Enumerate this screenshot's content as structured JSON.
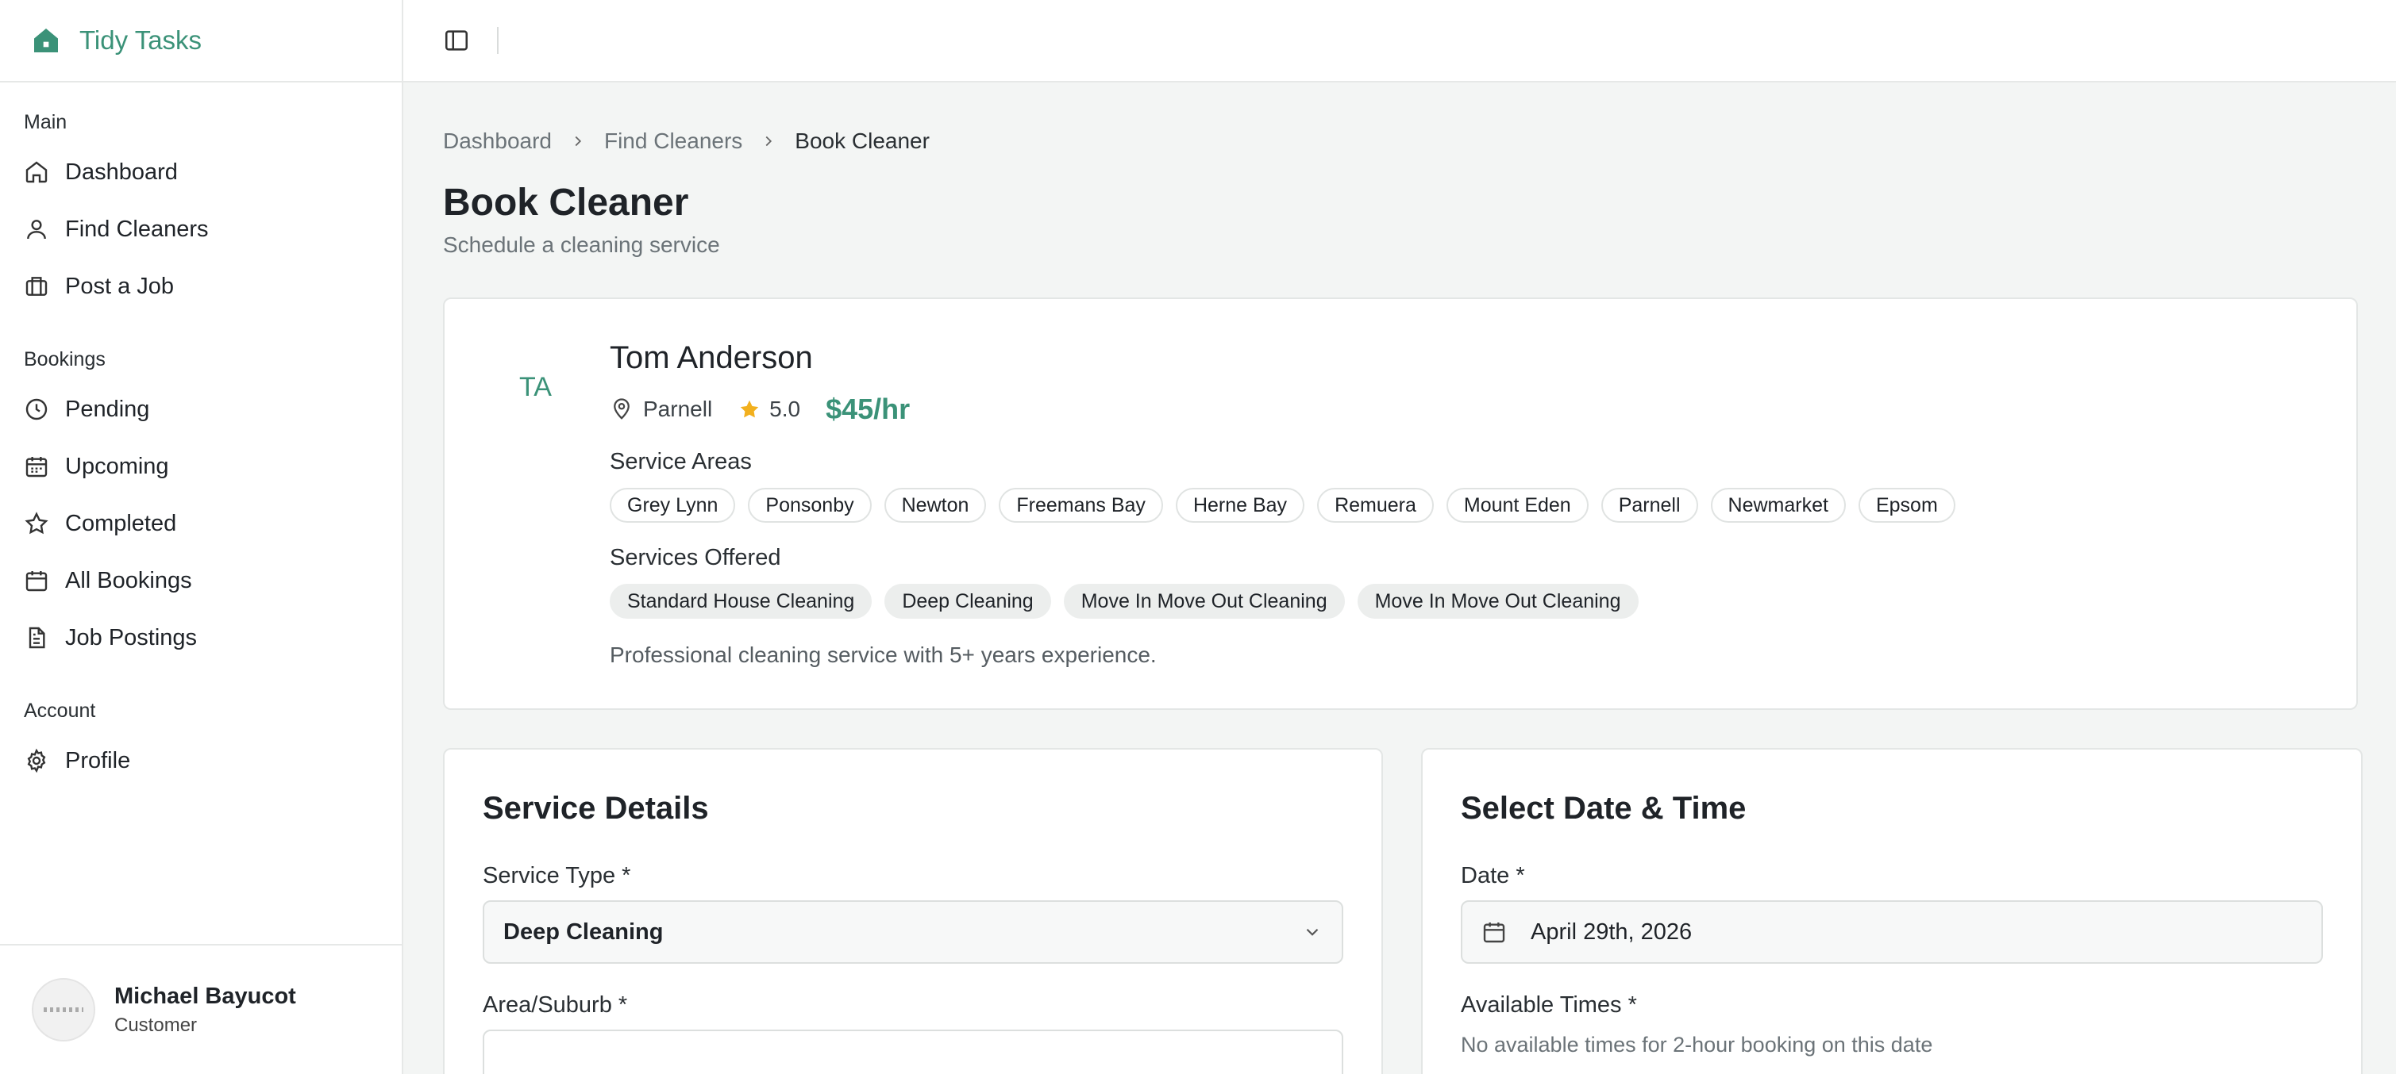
{
  "app": {
    "name": "Tidy Tasks"
  },
  "sidebar": {
    "sections": [
      {
        "label": "Main",
        "items": [
          {
            "label": "Dashboard",
            "icon": "home-icon"
          },
          {
            "label": "Find Cleaners",
            "icon": "user-icon"
          },
          {
            "label": "Post a Job",
            "icon": "briefcase-icon"
          }
        ]
      },
      {
        "label": "Bookings",
        "items": [
          {
            "label": "Pending",
            "icon": "clock-icon"
          },
          {
            "label": "Upcoming",
            "icon": "calendar-icon"
          },
          {
            "label": "Completed",
            "icon": "star-icon"
          },
          {
            "label": "All Bookings",
            "icon": "calendar-icon"
          },
          {
            "label": "Job Postings",
            "icon": "document-icon"
          }
        ]
      },
      {
        "label": "Account",
        "items": [
          {
            "label": "Profile",
            "icon": "gear-icon"
          }
        ]
      }
    ],
    "user": {
      "name": "Michael Bayucot",
      "role": "Customer"
    }
  },
  "breadcrumb": [
    "Dashboard",
    "Find Cleaners",
    "Book Cleaner"
  ],
  "page": {
    "title": "Book Cleaner",
    "subtitle": "Schedule a cleaning service"
  },
  "cleaner": {
    "initials": "TA",
    "name": "Tom Anderson",
    "location": "Parnell",
    "rating": "5.0",
    "rate": "$45/hr",
    "service_areas_label": "Service Areas",
    "service_areas": [
      "Grey Lynn",
      "Ponsonby",
      "Newton",
      "Freemans Bay",
      "Herne Bay",
      "Remuera",
      "Mount Eden",
      "Parnell",
      "Newmarket",
      "Epsom"
    ],
    "services_label": "Services Offered",
    "services": [
      "Standard House Cleaning",
      "Deep Cleaning",
      "Move In Move Out Cleaning",
      "Move In Move Out Cleaning"
    ],
    "description": "Professional cleaning service with 5+ years experience."
  },
  "service_details": {
    "title": "Service Details",
    "service_type_label": "Service Type *",
    "service_type_value": "Deep Cleaning",
    "area_label": "Area/Suburb *"
  },
  "date_time": {
    "title": "Select Date & Time",
    "date_label": "Date *",
    "date_value": "April 29th, 2026",
    "times_label": "Available Times *",
    "times_message": "No available times for 2-hour booking on this date"
  },
  "colors": {
    "accent": "#3b9278",
    "star": "#f2b01e"
  }
}
